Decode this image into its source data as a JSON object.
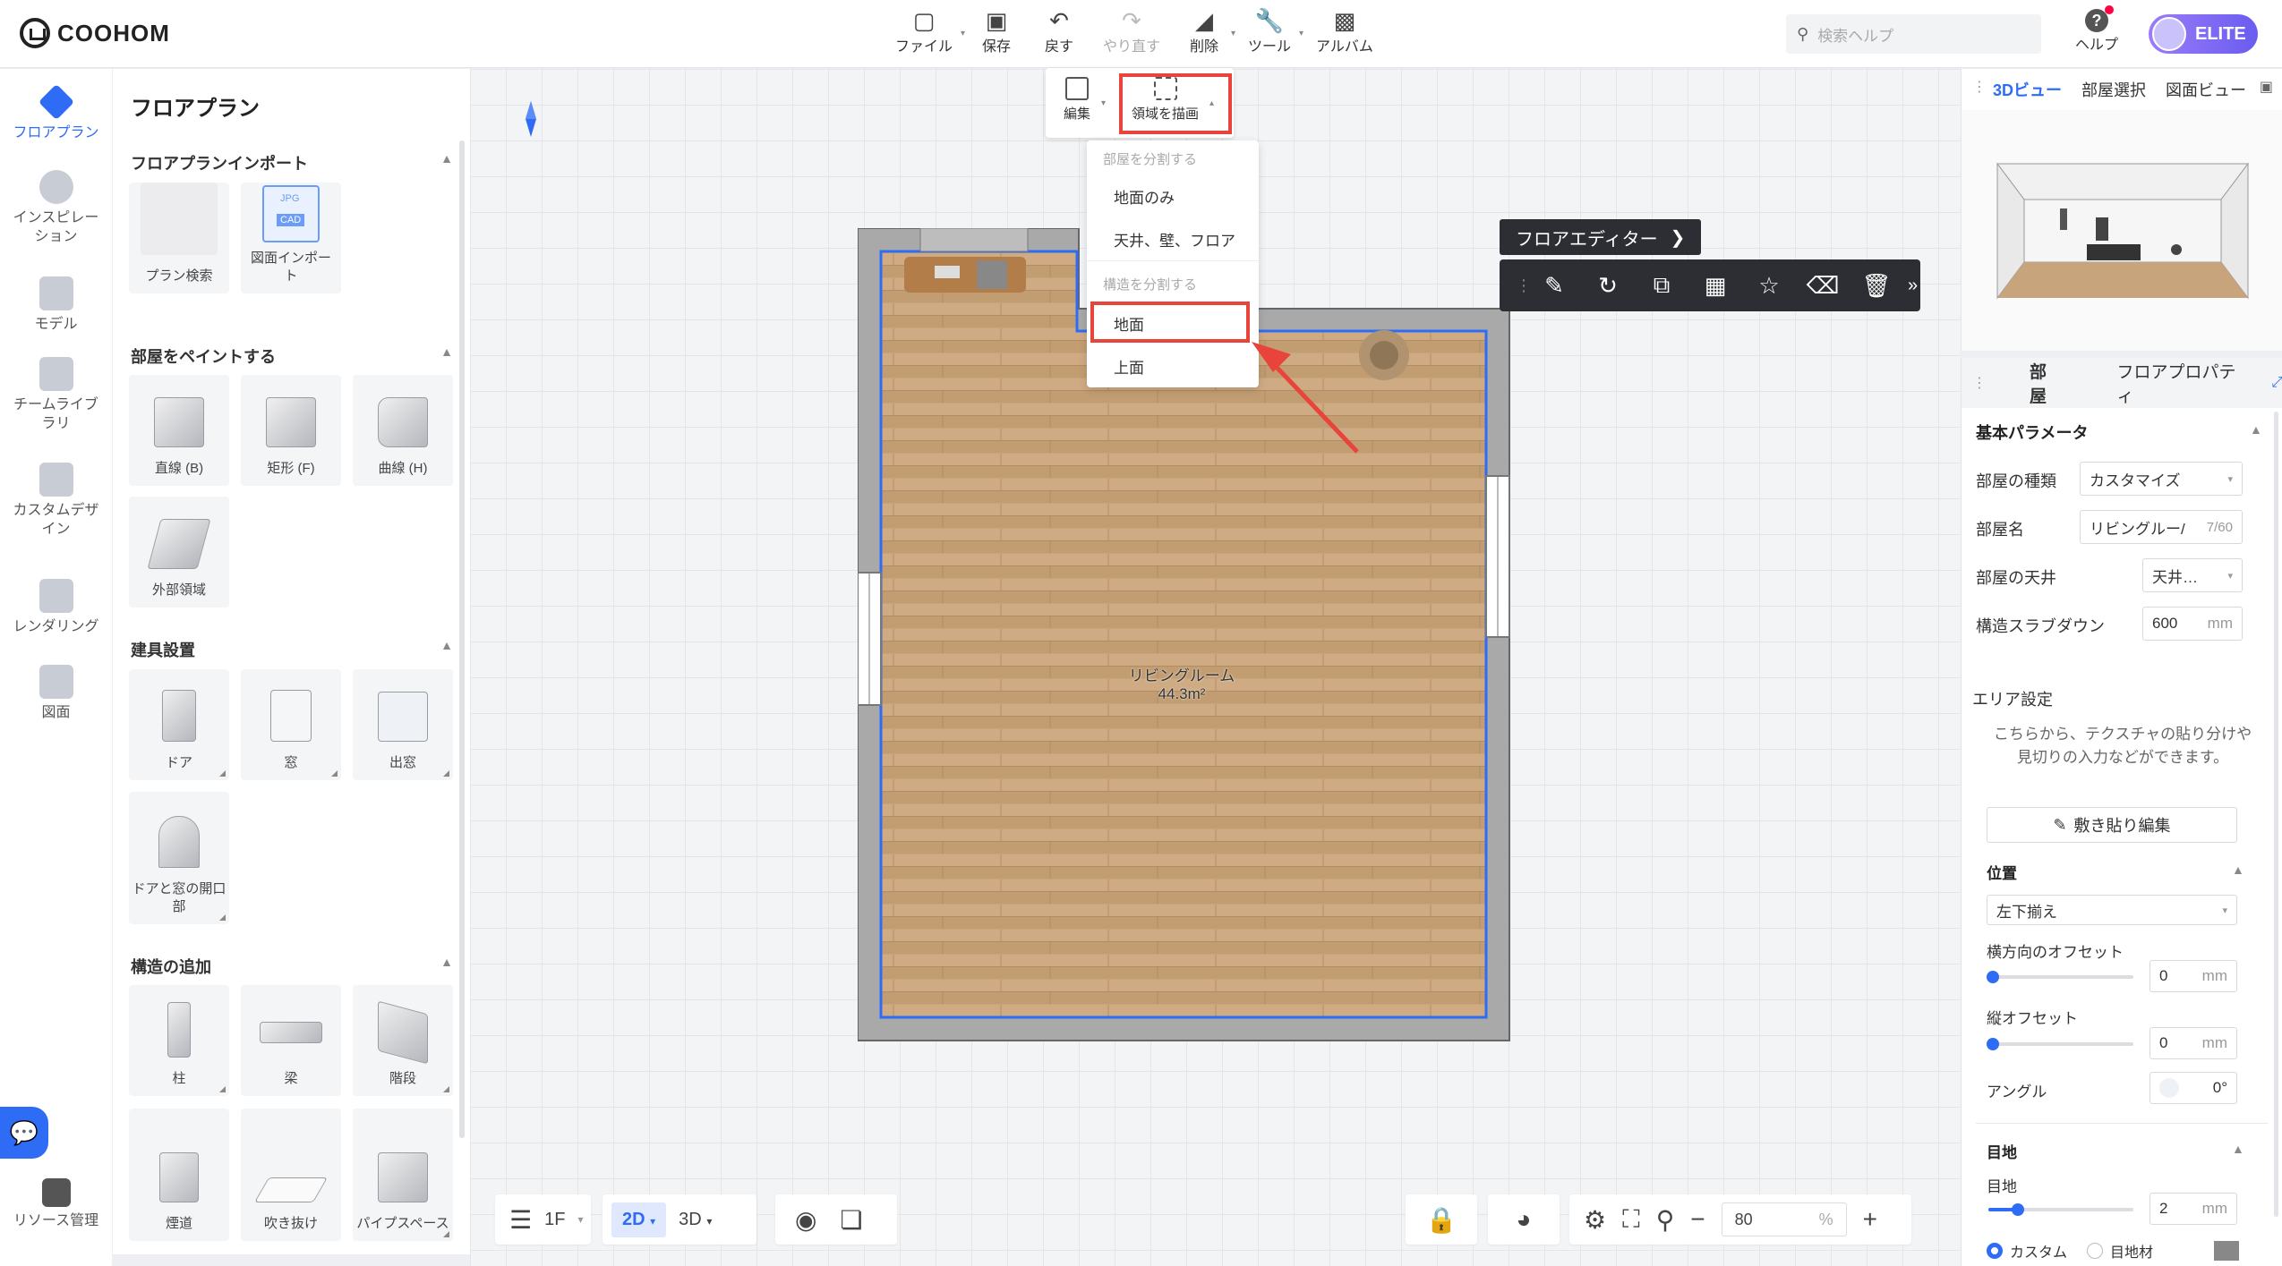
{
  "header": {
    "logo": "COOHOM",
    "tools": [
      {
        "label": "ファイル",
        "icon": "file-icon",
        "disabled": false
      },
      {
        "label": "保存",
        "icon": "save-icon",
        "disabled": false
      },
      {
        "label": "戻す",
        "icon": "undo-icon",
        "disabled": false
      },
      {
        "label": "やり直す",
        "icon": "redo-icon",
        "disabled": true
      },
      {
        "label": "削除",
        "icon": "eraser-icon",
        "disabled": false
      },
      {
        "label": "ツール",
        "icon": "wrench-icon",
        "disabled": false
      },
      {
        "label": "アルバム",
        "icon": "album-icon",
        "disabled": false
      }
    ],
    "search_placeholder": "検索ヘルプ",
    "help_label": "ヘルプ",
    "badge": "ELITE"
  },
  "leftnav": {
    "items": [
      {
        "label": "フロアプラン",
        "active": true
      },
      {
        "label": "インスピレーション",
        "active": false
      },
      {
        "label": "モデル",
        "active": false
      },
      {
        "label": "チームライブラリ",
        "active": false
      },
      {
        "label": "カスタムデザイン",
        "active": false
      },
      {
        "label": "レンダリング",
        "active": false
      },
      {
        "label": "図面",
        "active": false
      }
    ],
    "resource_label": "リソース管理"
  },
  "panel": {
    "title": "フロアプラン",
    "sections": {
      "import": {
        "title": "フロアプランインポート",
        "items": [
          "プラン検索",
          "図面インポート"
        ]
      },
      "paint": {
        "title": "部屋をペイントする",
        "items": [
          "直線 (B)",
          "矩形 (F)",
          "曲線 (H)",
          "外部領域"
        ]
      },
      "fixtures": {
        "title": "建具設置",
        "items": [
          "ドア",
          "窓",
          "出窓",
          "ドアと窓の開口部"
        ]
      },
      "structure": {
        "title": "構造の追加",
        "items": [
          "柱",
          "梁",
          "階段",
          "煙道",
          "吹き抜け",
          "パイプスペース"
        ]
      }
    },
    "import_icon_labels": {
      "jpg": "JPG",
      "cad": "CAD"
    }
  },
  "canvas": {
    "edit_button": "編集",
    "draw_area_button": "領域を描画",
    "dropdown": {
      "header1": "部屋を分割する",
      "item1": "地面のみ",
      "item2": "天井、壁、フロア",
      "header2": "構造を分割する",
      "item3": "地面",
      "item4": "上面"
    },
    "floor_editor": "フロアエディター",
    "room_name": "リビングルーム",
    "room_area": "44.3m²",
    "accent_color": "#2f6cf6",
    "highlight_color": "#e8443c"
  },
  "bottom": {
    "floor": "1F",
    "mode_2d": "2D",
    "mode_3d": "3D",
    "zoom": "80",
    "zoom_unit": "%"
  },
  "right": {
    "view_tabs": [
      "3Dビュー",
      "部屋選択",
      "図面ビュー"
    ],
    "prop_tabs": [
      "部屋",
      "フロアプロパティ"
    ],
    "basic_params": "基本パラメータ",
    "room_type_label": "部屋の種類",
    "room_type_value": "カスタマイズ",
    "room_name_label": "部屋名",
    "room_name_value": "リビングルー/",
    "room_name_count": "7/60",
    "ceiling_label": "部屋の天井",
    "ceiling_value": "天井…",
    "slab_label": "構造スラブダウン",
    "slab_value": "600",
    "slab_unit": "mm",
    "area_settings": "エリア設定",
    "area_desc": "こちらから、テクスチャの貼り分けや 見切りの入力などができます。",
    "tile_edit": "敷き貼り編集",
    "position": "位置",
    "position_value": "左下揃え",
    "h_offset_label": "横方向のオフセット",
    "h_offset_value": "0",
    "v_offset_label": "縦オフセット",
    "v_offset_value": "0",
    "angle_label": "アングル",
    "angle_value": "0°",
    "joint_section": "目地",
    "joint_label": "目地",
    "joint_value": "2",
    "unit_mm": "mm",
    "custom_label": "カスタム",
    "joint_material": "目地材"
  }
}
